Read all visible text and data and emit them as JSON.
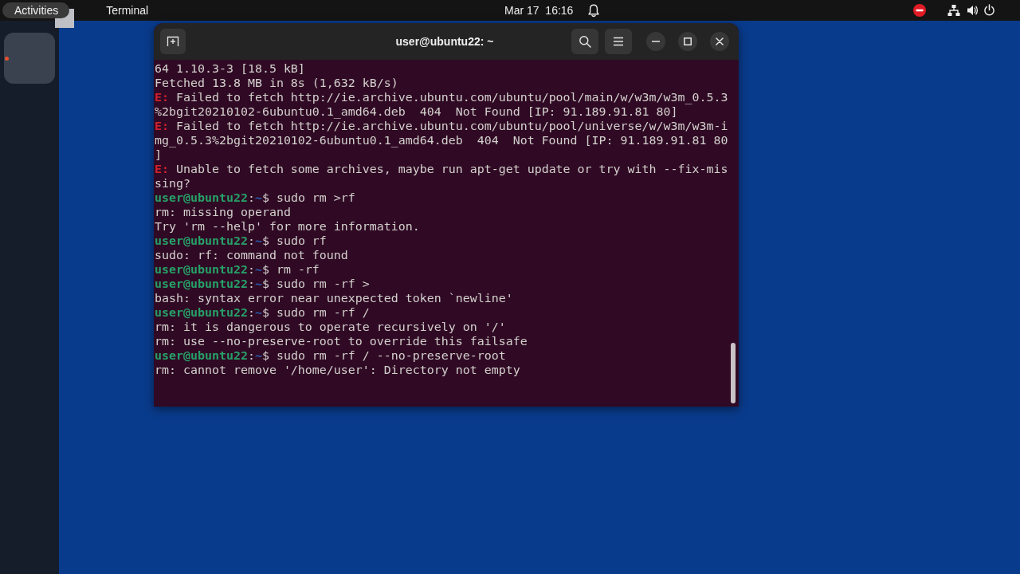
{
  "top_bar": {
    "activities": {
      "label": "Activities",
      "selected": true
    },
    "app_menu": "Terminal",
    "clock": "Mar 17  16:16"
  },
  "dock": {
    "apps": [
      {
        "running": true,
        "focused": true
      }
    ]
  },
  "terminal": {
    "title": "user@ubuntu22: ~",
    "lines": [
      {
        "kind": "output",
        "text": "64 1.10.3-3 [18.5 kB]"
      },
      {
        "kind": "output",
        "text": "Fetched 13.8 MB in 8s (1,632 kB/s)"
      },
      {
        "kind": "error",
        "tag": "E:",
        "text": "Failed to fetch http://ie.archive.ubuntu.com/ubuntu/pool/main/w/w3m/w3m_0.5.3"
      },
      {
        "kind": "output",
        "text": "%2bgit20210102-6ubuntu0.1_amd64.deb  404  Not Found [IP: 91.189.91.81 80]"
      },
      {
        "kind": "error",
        "tag": "E:",
        "text": "Failed to fetch http://ie.archive.ubuntu.com/ubuntu/pool/universe/w/w3m/w3m-i"
      },
      {
        "kind": "output",
        "text": "mg_0.5.3%2bgit20210102-6ubuntu0.1_amd64.deb  404  Not Found [IP: 91.189.91.81 80"
      },
      {
        "kind": "output",
        "text": "]"
      },
      {
        "kind": "error",
        "tag": "E:",
        "text": "Unable to fetch some archives, maybe run apt-get update or try with --fix-mis"
      },
      {
        "kind": "output",
        "text": "sing?"
      },
      {
        "kind": "prompt",
        "user": "user@ubuntu22",
        "sep": ":",
        "path": "~",
        "sigil": "$",
        "command": "sudo rm >rf"
      },
      {
        "kind": "output",
        "text": "rm: missing operand"
      },
      {
        "kind": "output",
        "text": "Try 'rm --help' for more information."
      },
      {
        "kind": "prompt",
        "user": "user@ubuntu22",
        "sep": ":",
        "path": "~",
        "sigil": "$",
        "command": "sudo rf"
      },
      {
        "kind": "output",
        "text": "sudo: rf: command not found"
      },
      {
        "kind": "prompt",
        "user": "user@ubuntu22",
        "sep": ":",
        "path": "~",
        "sigil": "$",
        "command": "rm -rf"
      },
      {
        "kind": "prompt",
        "user": "user@ubuntu22",
        "sep": ":",
        "path": "~",
        "sigil": "$",
        "command": "sudo rm -rf >"
      },
      {
        "kind": "output",
        "text": "bash: syntax error near unexpected token `newline'"
      },
      {
        "kind": "prompt",
        "user": "user@ubuntu22",
        "sep": ":",
        "path": "~",
        "sigil": "$",
        "command": "sudo rm -rf /"
      },
      {
        "kind": "output",
        "text": "rm: it is dangerous to operate recursively on '/'"
      },
      {
        "kind": "output",
        "text": "rm: use --no-preserve-root to override this failsafe"
      },
      {
        "kind": "prompt",
        "user": "user@ubuntu22",
        "sep": ":",
        "path": "~",
        "sigil": "$",
        "command": "sudo rm -rf / --no-preserve-root"
      },
      {
        "kind": "output",
        "text": "rm: cannot remove '/home/user': Directory not empty"
      }
    ]
  }
}
